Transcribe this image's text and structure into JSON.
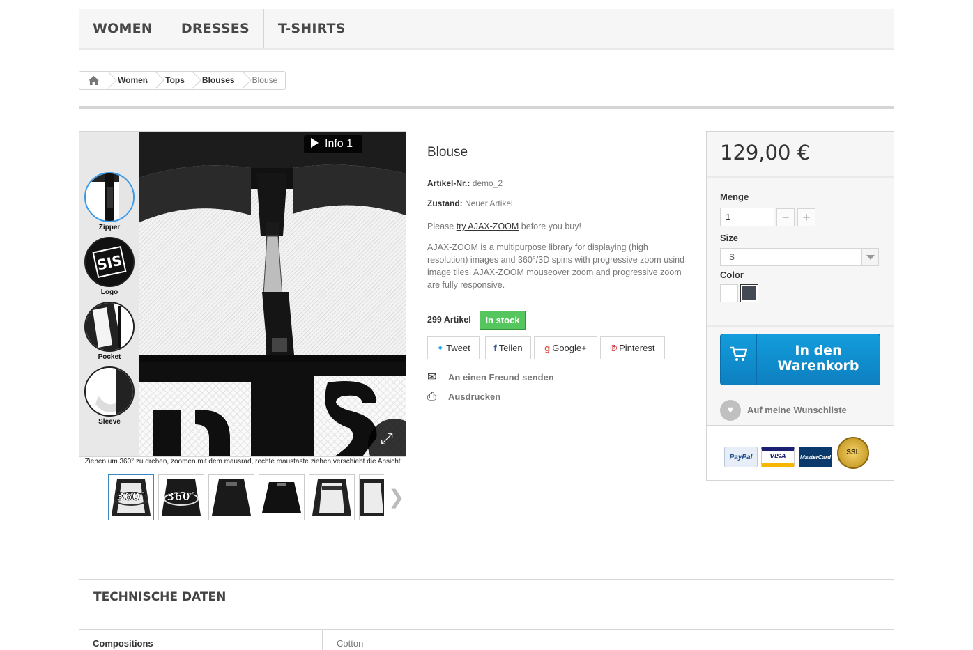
{
  "menu": {
    "items": [
      "WOMEN",
      "DRESSES",
      "T-SHIRTS"
    ]
  },
  "breadcrumb": {
    "home_icon": "home-icon",
    "items": [
      "Women",
      "Tops",
      "Blouses",
      "Blouse"
    ]
  },
  "viewer": {
    "info_button": "Info 1",
    "hotspots": [
      "Zipper",
      "Logo",
      "Pocket",
      "Sleeve"
    ],
    "logo_text": "SIS",
    "hint": "Ziehen um 360° zu drehen, zoomen mit dem mausrad, rechte maustaste ziehen verschiebt die Ansicht",
    "thumbnail_labels": [
      "360°",
      "360°"
    ]
  },
  "product": {
    "title": "Blouse",
    "ref_label": "Artikel-Nr.:",
    "ref_value": "demo_2",
    "condition_label": "Zustand:",
    "condition_value": "Neuer Artikel",
    "try_prefix": "Please",
    "try_link": "try AJAX-ZOOM",
    "try_suffix": "before you buy!",
    "description": "AJAX-ZOOM is a multipurpose library for displaying (high resolution) images and 360°/3D spins with progressive zoom usind image tiles. AJAX-ZOOM mouseover zoom and progressive zoom are fully responsive.",
    "quantity_text": "299 Artikel",
    "stock_badge": "In stock"
  },
  "social": {
    "tweet": "Tweet",
    "share": "Teilen",
    "google": "Google+",
    "pinterest": "Pinterest"
  },
  "links": {
    "send_friend": "An einen Freund senden",
    "print": "Ausdrucken"
  },
  "buybox": {
    "price": "129,00 €",
    "qty_label": "Menge",
    "qty_value": "1",
    "minus": "−",
    "plus": "+",
    "size_label": "Size",
    "size_value": "S",
    "color_label": "Color",
    "colors": [
      "#ffffff",
      "#434a54"
    ],
    "cart_button": "In den Warenkorb",
    "wishlist": "Auf meine Wunschliste",
    "payment_cards": [
      "PayPal",
      "VISA",
      "MasterCard",
      "SSL"
    ]
  },
  "tech": {
    "heading": "TECHNISCHE DATEN",
    "rows": [
      {
        "key": "Compositions",
        "value": "Cotton"
      }
    ]
  },
  "colors": {
    "accent_blue": "#1194d8",
    "stock_green": "#55c65e",
    "border": "#d6d4d4"
  }
}
